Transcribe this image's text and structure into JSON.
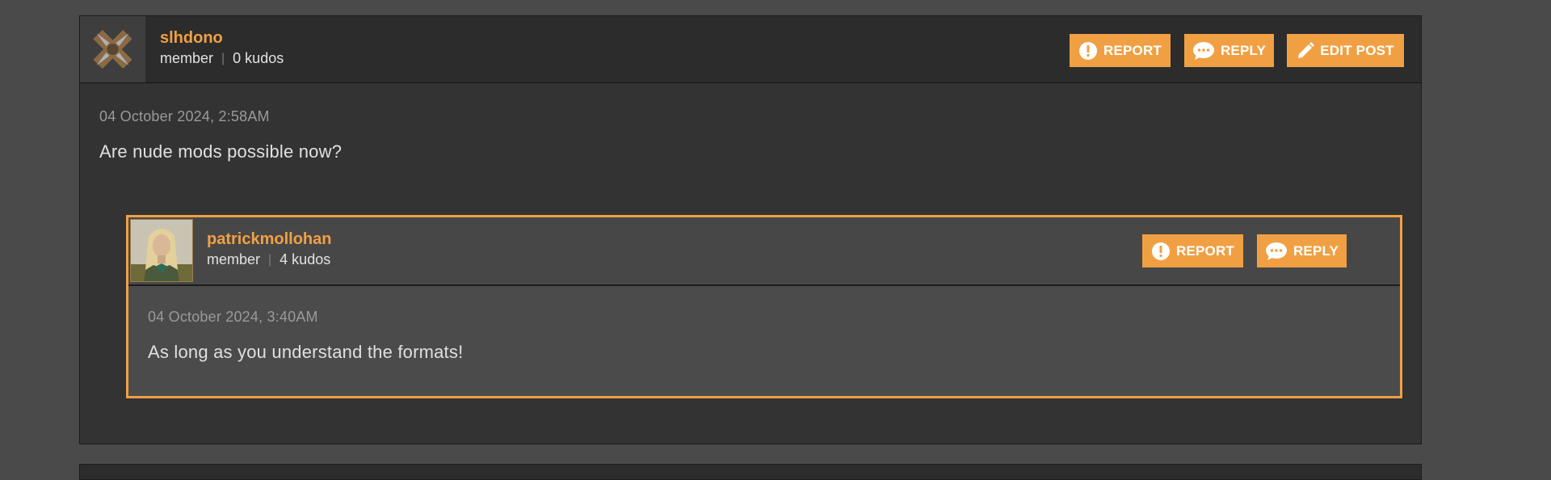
{
  "post": {
    "author": {
      "username": "slhdono",
      "role": "member",
      "kudos": "0 kudos"
    },
    "actions": {
      "report_label": "REPORT",
      "reply_label": "REPLY",
      "edit_label": "EDIT POST"
    },
    "timestamp": "04 October 2024, 2:58AM",
    "body": "Are nude mods possible now?"
  },
  "reply": {
    "author": {
      "username": "patrickmollohan",
      "role": "member",
      "kudos": "4 kudos"
    },
    "actions": {
      "report_label": "REPORT",
      "reply_label": "REPLY"
    },
    "timestamp": "04 October 2024, 3:40AM",
    "body": "As long as you understand the formats!"
  },
  "icons": {
    "report": "exclamation-circle-icon",
    "reply": "speech-bubble-icon",
    "edit": "pencil-icon"
  },
  "colors": {
    "accent": "#f0a043",
    "page_bg": "#4a4a4a",
    "post_bg": "#333333",
    "reply_bg": "#4b4b4b"
  }
}
